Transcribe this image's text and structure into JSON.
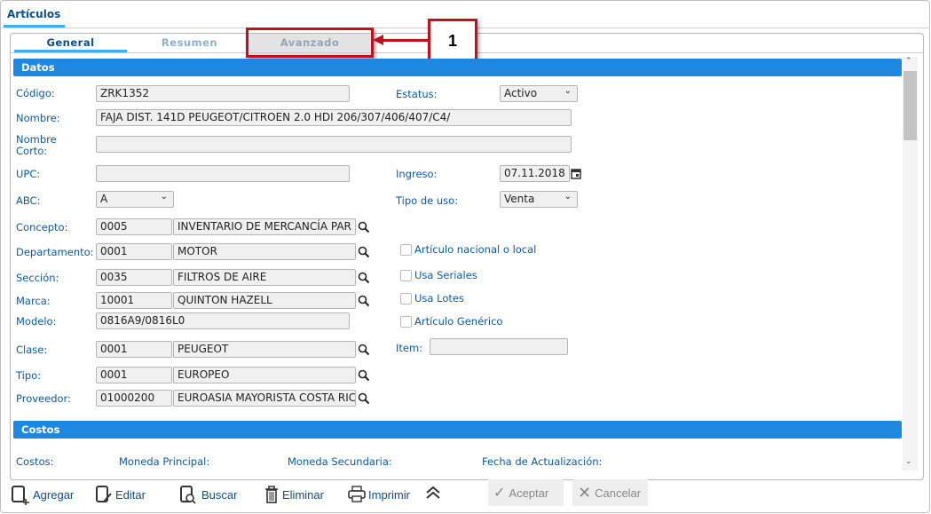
{
  "window": {
    "tab": "Artículos"
  },
  "subtabs": [
    {
      "label": "General",
      "active": true
    },
    {
      "label": "Resumen"
    },
    {
      "label": "Avanzado",
      "highlighted": true
    }
  ],
  "callout": {
    "number": "1",
    "color": "#c0121b"
  },
  "sections": {
    "datos": "Datos",
    "costos": "Costos"
  },
  "fields": {
    "codigo": {
      "label": "Código:",
      "value": "ZRK1352"
    },
    "nombre": {
      "label": "Nombre:",
      "value": "FAJA DIST. 141D PEUGEOT/CITROEN 2.0 HDI 206/307/406/407/C4/"
    },
    "nombre_corto": {
      "label": "Nombre Corto:",
      "value": ""
    },
    "upc": {
      "label": "UPC:",
      "value": ""
    },
    "abc": {
      "label": "ABC:",
      "value": "A"
    },
    "concepto": {
      "label": "Concepto:",
      "code": "0005",
      "value": "INVENTARIO DE MERCANCÍA PAR"
    },
    "departamento": {
      "label": "Departamento:",
      "code": "0001",
      "value": "MOTOR"
    },
    "seccion": {
      "label": "Sección:",
      "code": "0035",
      "value": "FILTROS DE AIRE"
    },
    "marca": {
      "label": "Marca:",
      "code": "10001",
      "value": "QUINTON HAZELL"
    },
    "modelo": {
      "label": "Modelo:",
      "value": "0816A9/0816L0"
    },
    "clase": {
      "label": "Clase:",
      "code": "0001",
      "value": "PEUGEOT"
    },
    "tipo": {
      "label": "Tipo:",
      "code": "0001",
      "value": "EUROPEO"
    },
    "proveedor": {
      "label": "Proveedor:",
      "code": "01000200",
      "value": "EUROASIA MAYORISTA COSTA RICA"
    },
    "estatus": {
      "label": "Estatus:",
      "value": "Activo"
    },
    "ingreso": {
      "label": "Ingreso:",
      "value": "07.11.2018"
    },
    "tipo_uso": {
      "label": "Tipo de uso:",
      "value": "Venta"
    },
    "item": {
      "label": "Item:",
      "value": ""
    }
  },
  "checkboxes": [
    {
      "label": "Artículo nacional o local",
      "checked": false
    },
    {
      "label": "Usa Seriales",
      "checked": false
    },
    {
      "label": "Usa Lotes",
      "checked": false
    },
    {
      "label": "Artículo Genérico",
      "checked": false
    }
  ],
  "costos": {
    "costos": "Costos:",
    "moneda_principal": "Moneda Principal:",
    "moneda_secundaria": "Moneda Secundaria:",
    "fecha": "Fecha de Actualización:"
  },
  "toolbar": {
    "agregar": "Agregar",
    "editar": "Editar",
    "buscar": "Buscar",
    "eliminar": "Eliminar",
    "imprimir": "Imprimir",
    "aceptar": "Aceptar",
    "cancelar": "Cancelar"
  }
}
